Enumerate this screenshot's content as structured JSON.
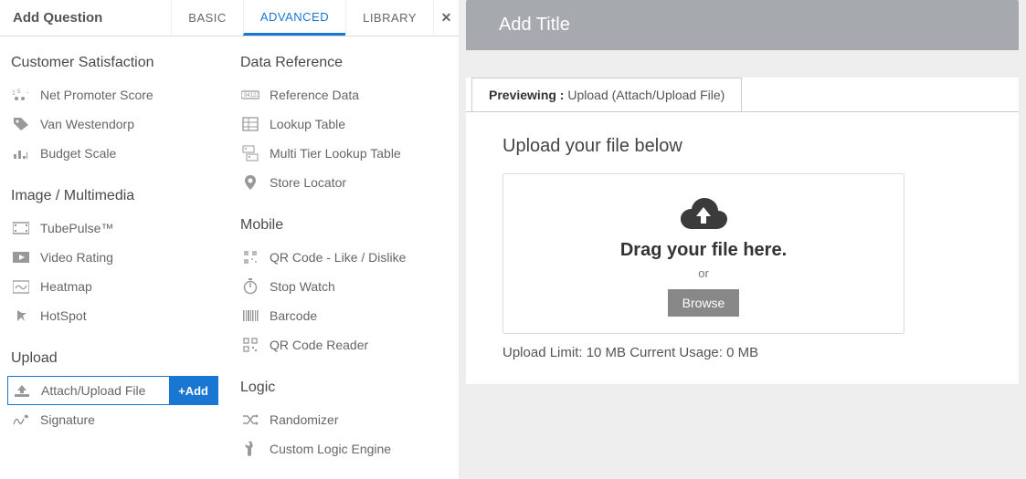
{
  "header": {
    "title": "Add Question",
    "tabs": [
      "BASIC",
      "ADVANCED",
      "LIBRARY"
    ],
    "active_tab": "ADVANCED"
  },
  "columns": {
    "left": [
      {
        "heading": "Customer Satisfaction",
        "items": [
          {
            "label": "Net Promoter Score",
            "icon": "nps-icon"
          },
          {
            "label": "Van Westendorp",
            "icon": "tag-icon"
          },
          {
            "label": "Budget Scale",
            "icon": "bars-icon"
          }
        ]
      },
      {
        "heading": "Image / Multimedia",
        "items": [
          {
            "label": "TubePulse™",
            "icon": "film-icon"
          },
          {
            "label": "Video Rating",
            "icon": "video-icon"
          },
          {
            "label": "Heatmap",
            "icon": "heatmap-icon"
          },
          {
            "label": "HotSpot",
            "icon": "hotspot-icon"
          }
        ]
      },
      {
        "heading": "Upload",
        "items": [
          {
            "label": "Attach/Upload File",
            "icon": "upload-icon",
            "selected": true,
            "add_label": "+Add"
          },
          {
            "label": "Signature",
            "icon": "signature-icon"
          }
        ]
      }
    ],
    "right": [
      {
        "heading": "Data Reference",
        "items": [
          {
            "label": "Reference Data",
            "icon": "refdata-icon"
          },
          {
            "label": "Lookup Table",
            "icon": "table-icon"
          },
          {
            "label": "Multi Tier Lookup Table",
            "icon": "multitier-icon"
          },
          {
            "label": "Store Locator",
            "icon": "pin-icon"
          }
        ]
      },
      {
        "heading": "Mobile",
        "items": [
          {
            "label": "QR Code - Like / Dislike",
            "icon": "qr-icon"
          },
          {
            "label": "Stop Watch",
            "icon": "stopwatch-icon"
          },
          {
            "label": "Barcode",
            "icon": "barcode-icon"
          },
          {
            "label": "QR Code Reader",
            "icon": "qrreader-icon"
          }
        ]
      },
      {
        "heading": "Logic",
        "items": [
          {
            "label": "Randomizer",
            "icon": "randomizer-icon"
          },
          {
            "label": "Custom Logic Engine",
            "icon": "wrench-icon"
          }
        ]
      }
    ]
  },
  "preview": {
    "title_placeholder": "Add Title",
    "previewing_label": "Previewing :",
    "previewing_value": "Upload (Attach/Upload File)",
    "upload_heading": "Upload your file below",
    "drag_text": "Drag your file here.",
    "or_text": "or",
    "browse_label": "Browse",
    "limit_text": "Upload Limit: 10 MB Current Usage: 0 MB"
  }
}
